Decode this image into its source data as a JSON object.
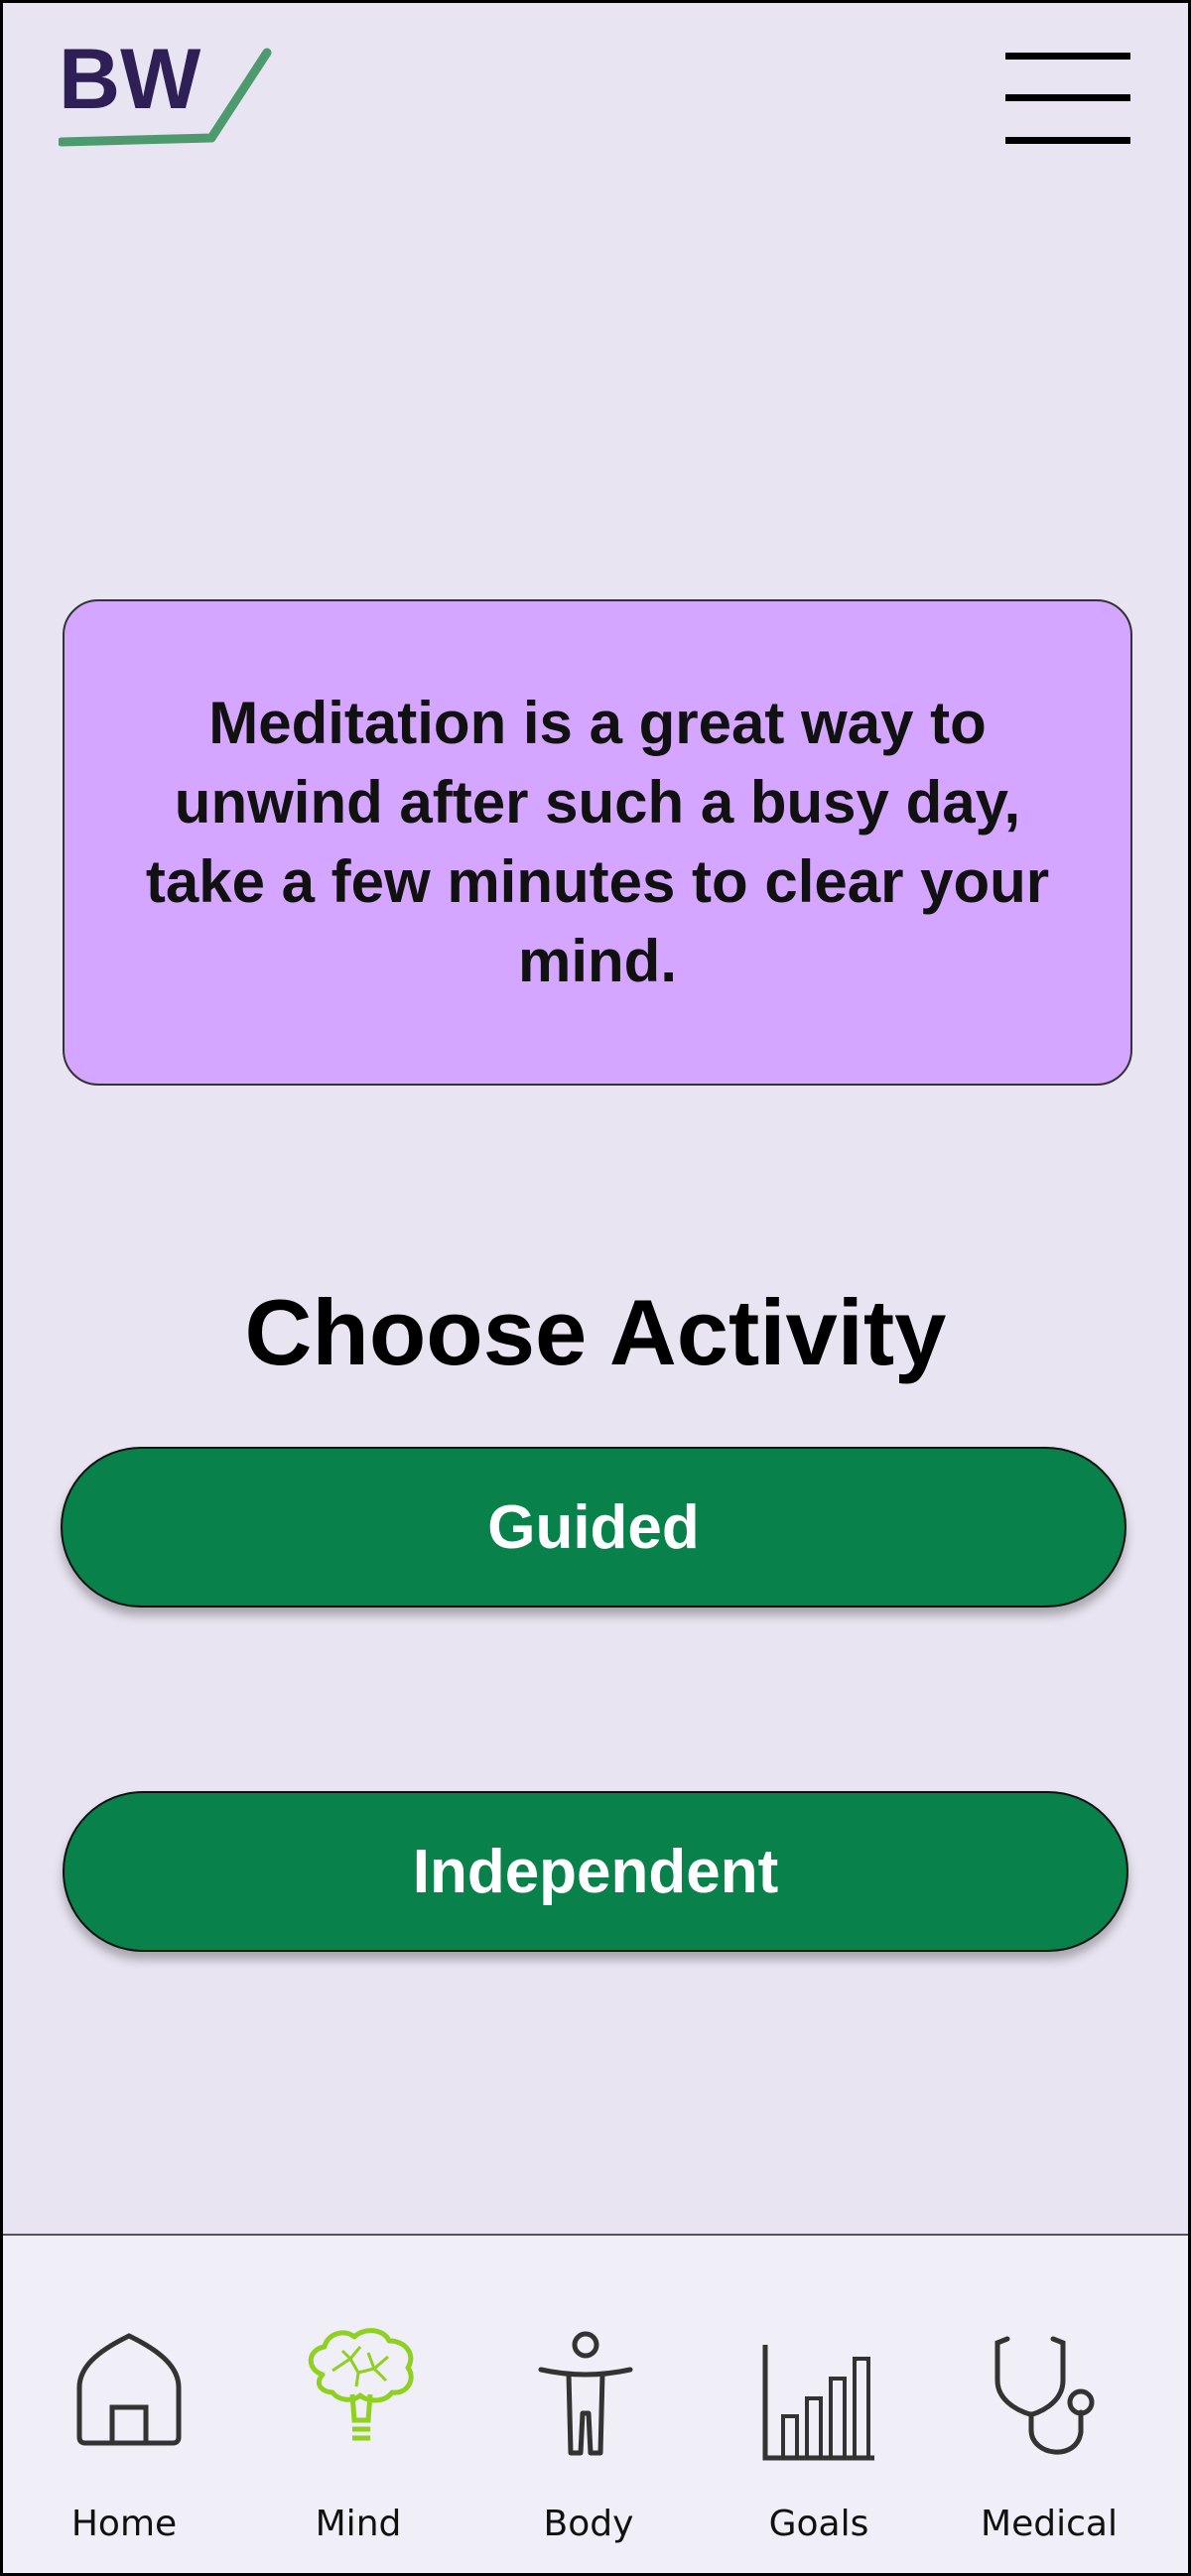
{
  "header": {
    "logo_text": "BW",
    "menu_icon": "hamburger-menu-icon"
  },
  "message": {
    "text": "Meditation is a great way to unwind after such a busy day, take a few minutes to clear your mind."
  },
  "activity": {
    "title": "Choose Activity",
    "guided_label": "Guided",
    "independent_label": "Independent"
  },
  "nav": {
    "items": [
      {
        "label": "Home",
        "icon": "home-icon",
        "active": false
      },
      {
        "label": "Mind",
        "icon": "brain-icon",
        "active": true
      },
      {
        "label": "Body",
        "icon": "body-icon",
        "active": false
      },
      {
        "label": "Goals",
        "icon": "bar-chart-icon",
        "active": false
      },
      {
        "label": "Medical",
        "icon": "stethoscope-icon",
        "active": false
      }
    ]
  },
  "colors": {
    "background": "#e8e4f1",
    "card": "#d4a6ff",
    "button": "#08814a",
    "logo_text": "#2e1f57",
    "logo_accent": "#4d9a6e",
    "active_icon": "#8ed11f",
    "nav_background": "#f0eef7"
  }
}
